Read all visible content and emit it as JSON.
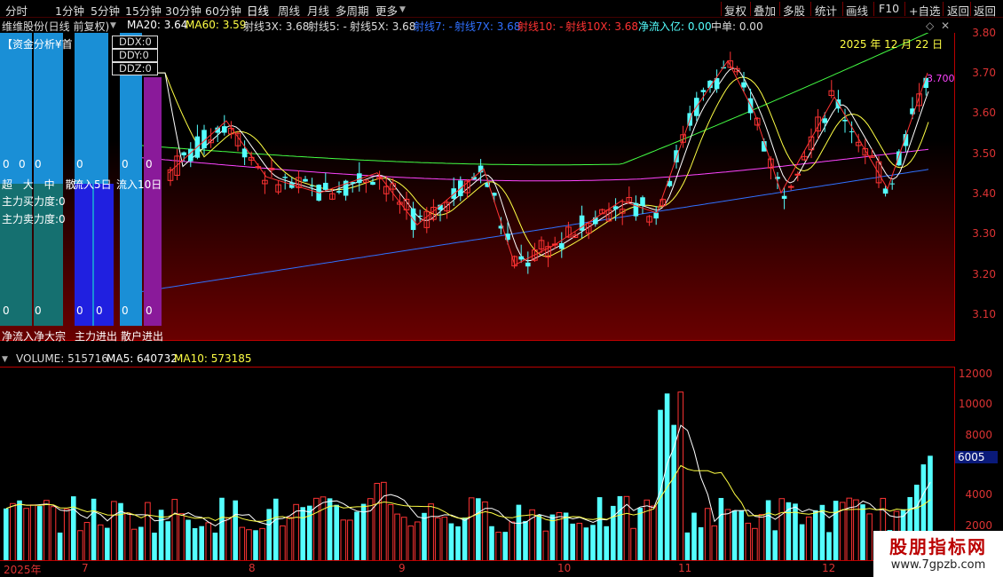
{
  "toolbar": {
    "timeframes": [
      "分时",
      "1分钟",
      "5分钟",
      "15分钟",
      "30分钟",
      "60分钟",
      "日线",
      "周线",
      "月线",
      "多周期",
      "更多"
    ],
    "active": "日线",
    "right_buttons": [
      "复权",
      "叠加",
      "多股",
      "统计",
      "画线",
      "F10",
      "+自选",
      "返回"
    ]
  },
  "info": {
    "title": "维维股份(日线 前复权)",
    "ma20": "MA20: 3.64",
    "ma60": "MA60: 3.59",
    "s3x": "射线3X: 3.68",
    "s5": "射线5: -",
    "s5x": "射线5X: 3.68",
    "s7": "射线7: -",
    "s7x": "射线7X: 3.68",
    "s10": "射线10: -",
    "s10x": "射线10X: 3.68",
    "inflow": "净流入亿: 0.00",
    "mid": "中单: 0.00"
  },
  "colors": {
    "up": "#ff3333",
    "down": "#54ffff",
    "ma5": "#ffffff",
    "ma10": "#ffff44",
    "ma20": "#ff44ff",
    "ma60": "#44ff44",
    "blue": "#3070ff",
    "purple": "#aa22aa"
  },
  "price_axis": [
    "3.80",
    "3.70",
    "3.60",
    "3.50",
    "3.40",
    "3.30",
    "3.20",
    "3.10"
  ],
  "date_label": "2025 年 12 月 22 日",
  "last_price": "3.700",
  "panel": {
    "title": "【资金分析¥首",
    "ddx": "DDX:0",
    "ddy": "DDY:0",
    "ddz": "DDZ:0",
    "zeros": [
      "0",
      "0",
      "0",
      "0",
      "0",
      "0"
    ],
    "row_headers": "超 大 中 散",
    "flow5": "流入5日",
    "flow10": "流入10日",
    "buy": "主力买力度:0",
    "sell": "主力卖力度:0",
    "bottom_zeros": [
      "0",
      "0",
      "0",
      "0",
      "0",
      "0",
      "0"
    ],
    "footer1": "净流入净大宗",
    "footer2": "主力进出",
    "footer3": "散户进出"
  },
  "volume": {
    "volume": "VOLUME: 515716",
    "ma5": "MA5: 640732",
    "ma10": "MA10: 573185",
    "axis": [
      "12000",
      "10000",
      "8000",
      "6000",
      "4000",
      "2000"
    ],
    "current": "6005"
  },
  "dates": [
    "2025年",
    "7",
    "8",
    "9",
    "10",
    "11",
    "12"
  ],
  "watermark": {
    "line1": "股朋指标网",
    "line2": "www.7gpzb.com"
  }
}
